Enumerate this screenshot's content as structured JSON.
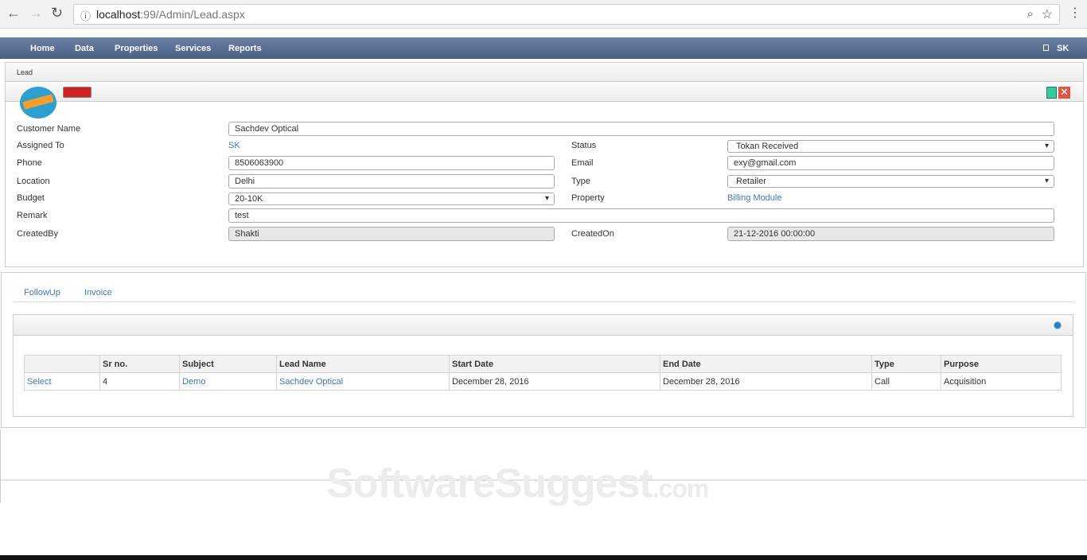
{
  "browser": {
    "host": "localhost",
    "path": ":99/Admin/Lead.aspx"
  },
  "nav": {
    "items": [
      "Home",
      "Data",
      "Properties",
      "Services",
      "Reports"
    ],
    "user": "SK"
  },
  "breadcrumb": "Lead",
  "form": {
    "customer_name_label": "Customer Name",
    "customer_name": "Sachdev Optical",
    "assigned_to_label": "Assigned To",
    "assigned_to": "SK",
    "status_label": "Status",
    "status": "Tokan Received",
    "phone_label": "Phone",
    "phone": "8506063900",
    "email_label": "Email",
    "email": "exy@gmail.com",
    "location_label": "Location",
    "location": "Delhi",
    "type_label": "Type",
    "type": "Retailer",
    "budget_label": "Budget",
    "budget": "20-10K",
    "property_label": "Property",
    "property": "Billing Module",
    "remark_label": "Remark",
    "remark": "test",
    "created_by_label": "CreatedBy",
    "created_by": "Shakti",
    "created_on_label": "CreatedOn",
    "created_on": "21-12-2016 00:00:00"
  },
  "tabs": [
    "FollowUp",
    "Invoice"
  ],
  "table": {
    "headers": [
      "",
      "Sr no.",
      "Subject",
      "Lead Name",
      "Start Date",
      "End Date",
      "Type",
      "Purpose"
    ],
    "rows": [
      [
        "Select",
        "4",
        "Demo",
        "Sachdev Optical",
        "December 28, 2016",
        "December 28, 2016",
        "Call",
        "Acquisition"
      ]
    ]
  },
  "watermark": {
    "main": "SoftwareSuggest",
    "suffix": ".com"
  }
}
